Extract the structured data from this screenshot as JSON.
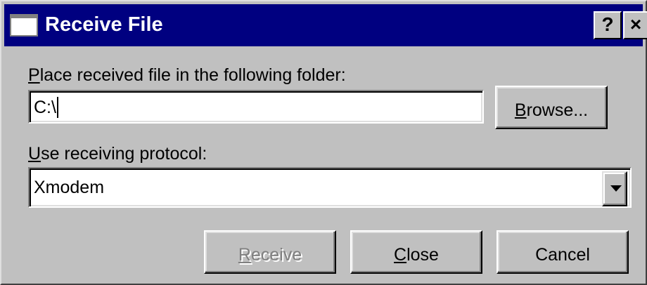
{
  "window": {
    "title": "Receive File",
    "help_glyph": "?",
    "close_glyph": "×"
  },
  "folder": {
    "label_accel": "P",
    "label_rest": "lace received file in the following folder:",
    "value": "C:\\",
    "browse_accel": "B",
    "browse_rest": "rowse..."
  },
  "protocol": {
    "label_accel": "U",
    "label_rest": "se receiving protocol:",
    "selected": "Xmodem"
  },
  "buttons": {
    "receive_accel": "R",
    "receive_rest": "eceive",
    "close_accel": "C",
    "close_rest": "lose",
    "cancel": "Cancel"
  },
  "icons": {
    "window_icon": "window-icon",
    "dropdown_arrow": "chevron-down-icon"
  },
  "colors": {
    "titlebar": "#000080",
    "face": "#c0c0c0",
    "disabled_text": "#808080"
  },
  "state": {
    "receive_enabled": false
  }
}
